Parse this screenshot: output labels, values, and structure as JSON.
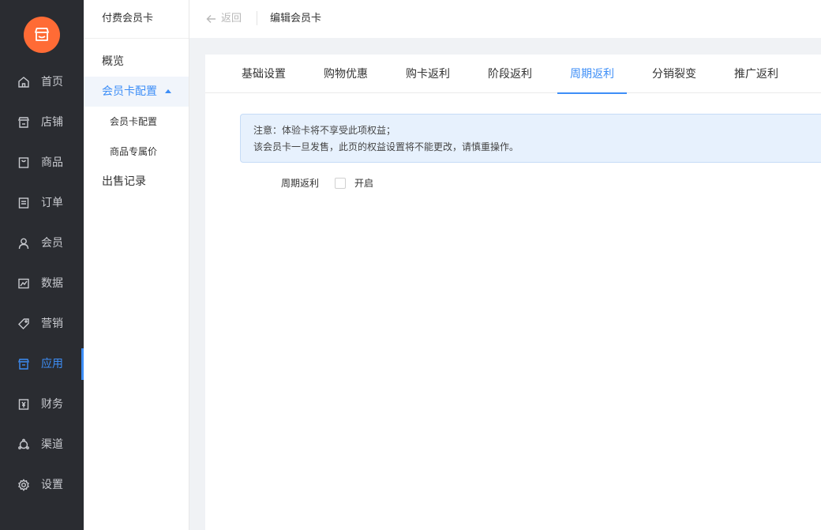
{
  "nav": {
    "items": [
      {
        "label": "首页",
        "icon": "home-icon"
      },
      {
        "label": "店铺",
        "icon": "store-icon"
      },
      {
        "label": "商品",
        "icon": "goods-icon"
      },
      {
        "label": "订单",
        "icon": "order-icon"
      },
      {
        "label": "会员",
        "icon": "member-icon"
      },
      {
        "label": "数据",
        "icon": "data-icon"
      },
      {
        "label": "营销",
        "icon": "tag-icon"
      },
      {
        "label": "应用",
        "icon": "app-icon"
      },
      {
        "label": "财务",
        "icon": "finance-icon"
      },
      {
        "label": "渠道",
        "icon": "channel-icon"
      },
      {
        "label": "设置",
        "icon": "gear-icon"
      }
    ],
    "active": "应用",
    "colors": {
      "logo": "#ff6b35",
      "accent": "#3d8ef7",
      "bg": "#2a2c31"
    }
  },
  "subnav": {
    "title": "付费会员卡",
    "overview": "概览",
    "config_group": "会员卡配置",
    "config_items": [
      "会员卡配置",
      "商品专属价"
    ],
    "sales_record": "出售记录"
  },
  "header": {
    "back_label": "返回",
    "title": "编辑会员卡"
  },
  "tabs": {
    "items": [
      "基础设置",
      "购物优惠",
      "购卡返利",
      "阶段返利",
      "周期返利",
      "分销裂变",
      "推广返利"
    ],
    "active": "周期返利"
  },
  "notice": {
    "line1": "注意：体验卡将不享受此项权益；",
    "line2": "该会员卡一旦发售，此页的权益设置将不能更改，请慎重操作。"
  },
  "form": {
    "field_label": "周期返利",
    "checkbox_label": "开启",
    "checked": false
  }
}
